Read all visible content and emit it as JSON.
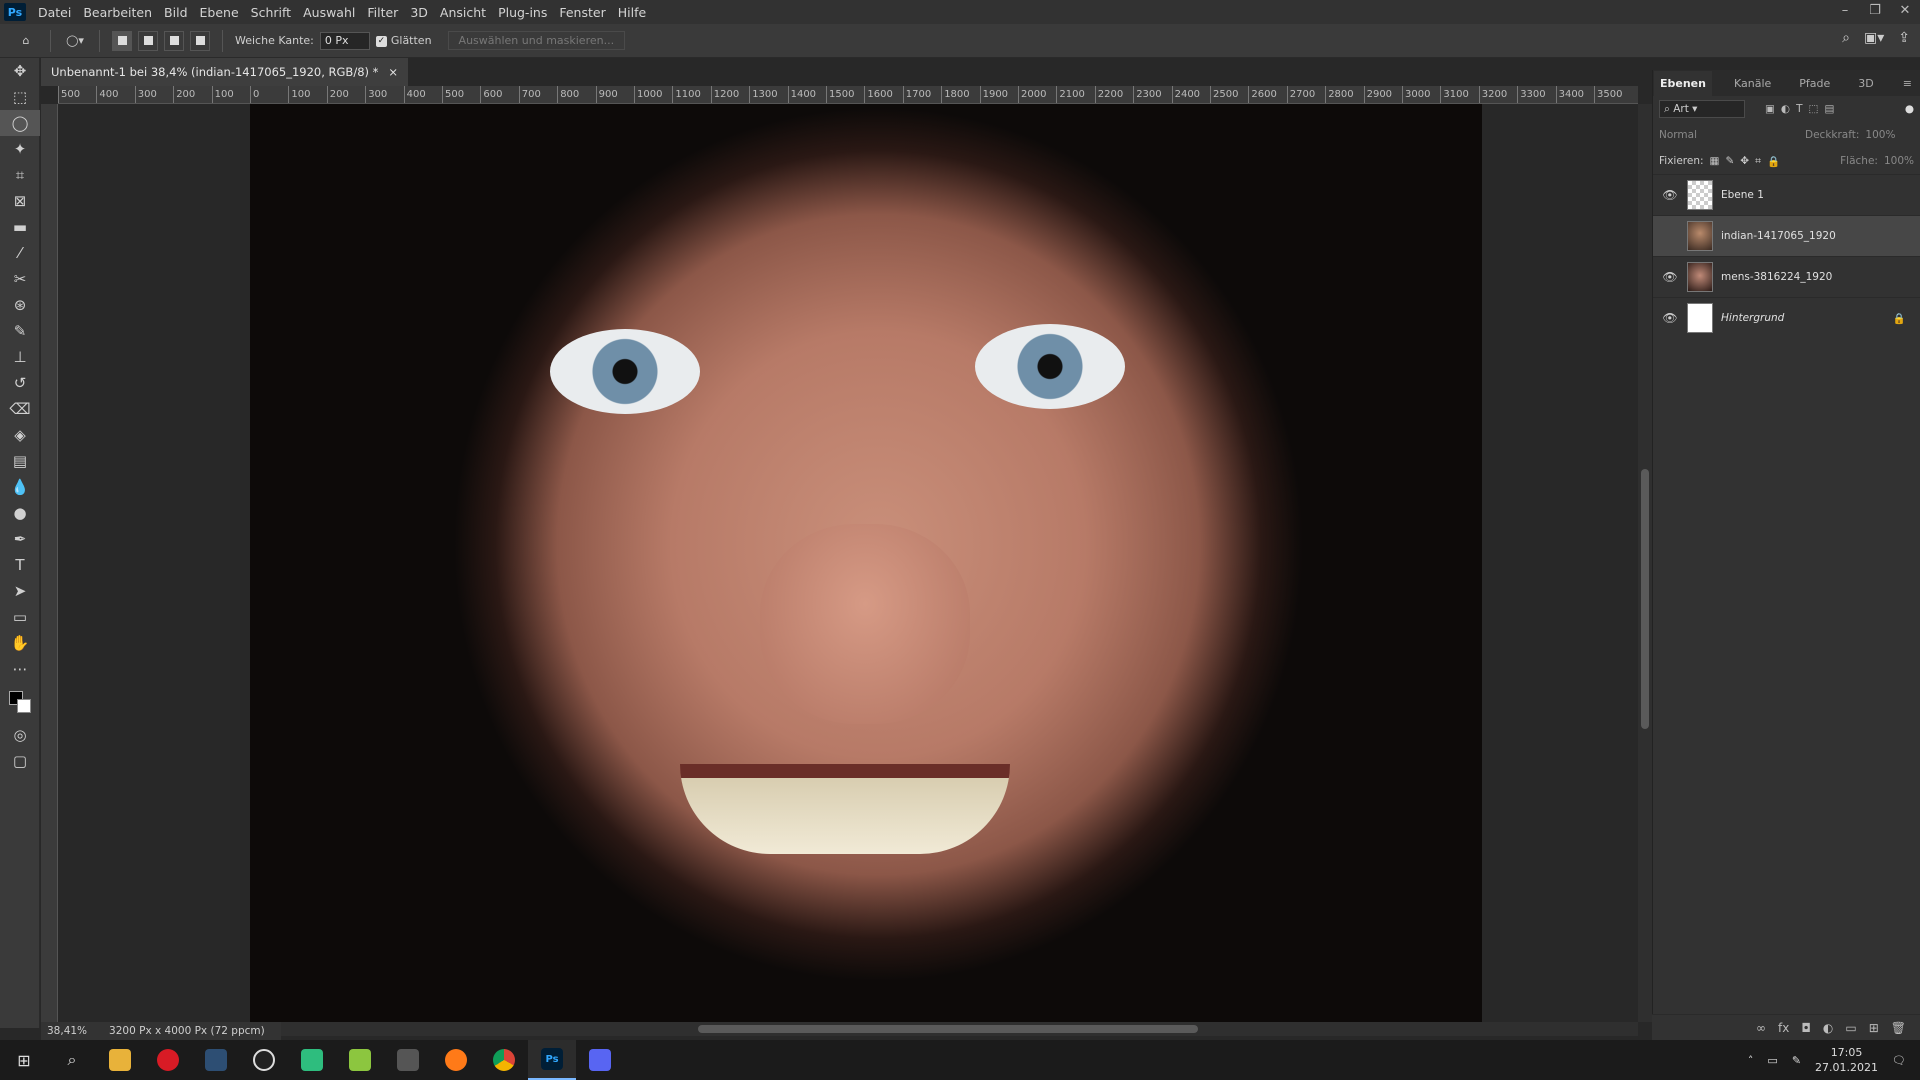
{
  "app": {
    "logo": "Ps"
  },
  "menu": [
    "Datei",
    "Bearbeiten",
    "Bild",
    "Ebene",
    "Schrift",
    "Auswahl",
    "Filter",
    "3D",
    "Ansicht",
    "Plug-ins",
    "Fenster",
    "Hilfe"
  ],
  "window_controls": {
    "minimize": "–",
    "restore": "❐",
    "close": "✕"
  },
  "options": {
    "feather_label": "Weiche Kante:",
    "feather_value": "0 Px",
    "antialias_label": "Glätten",
    "select_mask_label": "Auswählen und maskieren..."
  },
  "document": {
    "tab_title": "Unbenannt-1 bei 38,4% (indian-1417065_1920, RGB/8) *",
    "close_glyph": "×"
  },
  "ruler_ticks": [
    "500",
    "400",
    "300",
    "200",
    "100",
    "0",
    "100",
    "200",
    "300",
    "400",
    "500",
    "600",
    "700",
    "800",
    "900",
    "1000",
    "1100",
    "1200",
    "1300",
    "1400",
    "1500",
    "1600",
    "1700",
    "1800",
    "1900",
    "2000",
    "2100",
    "2200",
    "2300",
    "2400",
    "2500",
    "2600",
    "2700",
    "2800",
    "2900",
    "3000",
    "3100",
    "3200",
    "3300",
    "3400",
    "3500"
  ],
  "status": {
    "zoom": "38,41%",
    "doc_size": "3200 Px x 4000 Px (72 ppcm)"
  },
  "panel": {
    "tabs": [
      "Ebenen",
      "Kanäle",
      "Pfade",
      "3D"
    ],
    "filter_label": "Art",
    "blend_mode": "Normal",
    "opacity_label": "Deckkraft:",
    "opacity_value": "100%",
    "lock_label": "Fixieren:",
    "fill_label": "Fläche:",
    "fill_value": "100%",
    "layers": [
      {
        "name": "Ebene 1",
        "visible": true,
        "selected": false,
        "thumb": "checker"
      },
      {
        "name": "indian-1417065_1920",
        "visible": false,
        "selected": true,
        "thumb": "photo1"
      },
      {
        "name": "mens-3816224_1920",
        "visible": true,
        "selected": false,
        "thumb": "photo2"
      },
      {
        "name": "Hintergrund",
        "visible": true,
        "selected": false,
        "thumb": "white",
        "locked": true
      }
    ]
  },
  "taskbar": {
    "time": "17:05",
    "date": "27.01.2021"
  },
  "colors": {
    "accent": "#31a8ff",
    "ps_bg": "#001e36"
  }
}
